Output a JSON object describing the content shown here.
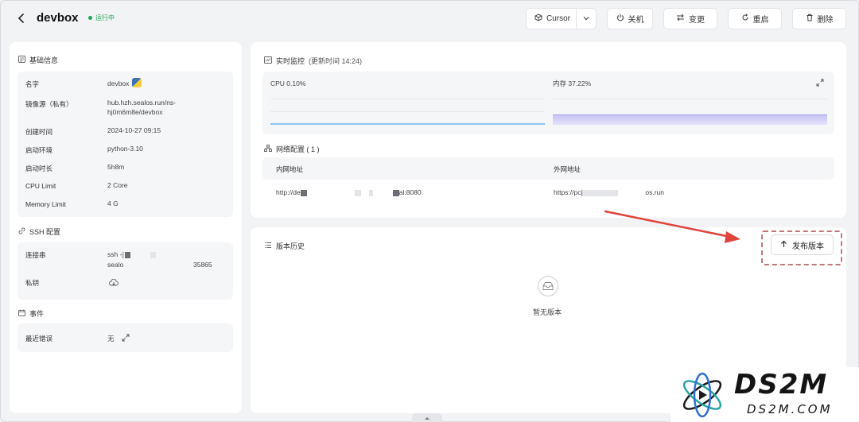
{
  "header": {
    "back_icon": "chevron-left-icon",
    "title": "devbox",
    "status": "运行中",
    "status_color": "#21a45a",
    "ide_label": "Cursor",
    "shutdown_label": "关机",
    "change_label": "变更",
    "restart_label": "重启",
    "delete_label": "删除"
  },
  "basic_info": {
    "title": "基础信息",
    "rows": [
      {
        "label": "名字",
        "value": "devbox"
      },
      {
        "label": "镜像源（私有）",
        "value": "hub.hzh.sealos.run/ns-",
        "value2": "hj0m6m8e/devbox"
      },
      {
        "label": "创建时间",
        "value": "2024-10-27 09:15"
      },
      {
        "label": "启动环境",
        "value": "python-3.10"
      },
      {
        "label": "启动时长",
        "value": "5h8m"
      },
      {
        "label": "CPU Limit",
        "value": "2 Core"
      },
      {
        "label": "Memory Limit",
        "value": "4 G"
      }
    ]
  },
  "ssh": {
    "title": "SSH 配置",
    "conn_label": "连接串",
    "conn_prefix": "ssh -",
    "conn_line2": "sealo",
    "conn_port": "35865",
    "key_label": "私钥"
  },
  "events": {
    "title": "事件",
    "last_error_label": "最近错误",
    "last_error_value": "无"
  },
  "monitor": {
    "title": "实时监控",
    "updated": "(更新时间  14:24)",
    "cpu_label": "CPU 0.10%",
    "mem_label": "内存 37.22%",
    "cpu_color": "#8ec5f0",
    "mem_color": "#b6b3f0"
  },
  "network": {
    "title": "网络配置 ( 1 )",
    "col_internal": "内网地址",
    "col_external": "外网地址",
    "internal_prefix": "http://de",
    "internal_suffix": "al:8080",
    "external_prefix": "https://pcj",
    "external_suffix": "os.run"
  },
  "versions": {
    "title": "版本历史",
    "publish_label": "发布版本",
    "empty_label": "暂无版本"
  },
  "watermark": {
    "brand": "DS2M",
    "domain": "DS2M.COM"
  }
}
